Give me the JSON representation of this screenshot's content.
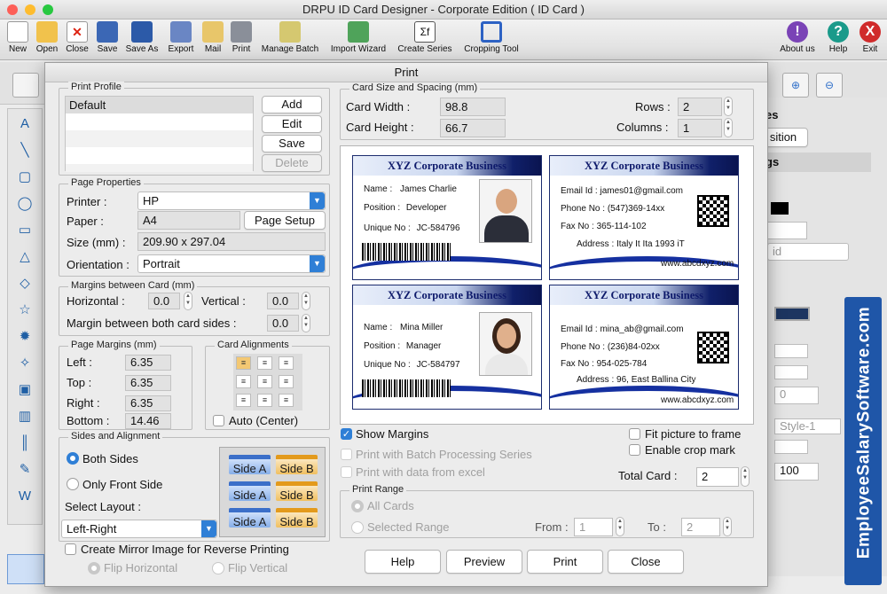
{
  "app": {
    "title": "DRPU ID Card Designer - Corporate Edition ( ID Card )"
  },
  "toolbar": {
    "items": [
      {
        "label": "New",
        "icon": "new-icon"
      },
      {
        "label": "Open",
        "icon": "open-icon"
      },
      {
        "label": "Close",
        "icon": "close-doc-icon"
      },
      {
        "label": "Save",
        "icon": "save-icon"
      },
      {
        "label": "Save As",
        "icon": "save-as-icon"
      },
      {
        "label": "Export",
        "icon": "export-icon"
      },
      {
        "label": "Mail",
        "icon": "mail-icon"
      },
      {
        "label": "Print",
        "icon": "print-icon"
      },
      {
        "label": "Manage Batch",
        "icon": "manage-batch-icon"
      },
      {
        "label": "Import Wizard",
        "icon": "import-wizard-icon"
      },
      {
        "label": "Create Series",
        "icon": "create-series-icon"
      },
      {
        "label": "Cropping Tool",
        "icon": "cropping-tool-icon"
      }
    ],
    "right_items": [
      {
        "label": "About us",
        "glyph": "!"
      },
      {
        "label": "Help",
        "glyph": "?"
      },
      {
        "label": "Exit",
        "glyph": "X"
      }
    ]
  },
  "background_panel": {
    "labels": [
      "es",
      "sition",
      "gs"
    ],
    "values": [
      "id",
      "0",
      "Style-1",
      "100"
    ]
  },
  "dialog": {
    "title": "Print",
    "print_profile": {
      "legend": "Print Profile",
      "items": [
        "Default"
      ],
      "buttons": {
        "add": "Add",
        "edit": "Edit",
        "save": "Save",
        "delete": "Delete"
      }
    },
    "page_properties": {
      "legend": "Page Properties",
      "printer_label": "Printer :",
      "printer_value": "HP",
      "paper_label": "Paper :",
      "paper_value": "A4",
      "page_setup": "Page Setup",
      "size_label": "Size (mm) :",
      "size_value": "209.90 x 297.04",
      "orientation_label": "Orientation :",
      "orientation_value": "Portrait"
    },
    "margins_between_card": {
      "legend": "Margins between Card (mm)",
      "horizontal_label": "Horizontal :",
      "horizontal_value": "0.0",
      "vertical_label": "Vertical :",
      "vertical_value": "0.0",
      "both_sides_label": "Margin between both card sides :",
      "both_sides_value": "0.0"
    },
    "page_margins": {
      "legend": "Page Margins (mm)",
      "left_label": "Left :",
      "left_value": "6.35",
      "top_label": "Top :",
      "top_value": "6.35",
      "right_label": "Right :",
      "right_value": "6.35",
      "bottom_label": "Bottom :",
      "bottom_value": "14.46"
    },
    "card_alignments": {
      "legend": "Card Alignments",
      "auto_center": "Auto (Center)"
    },
    "sides_alignment": {
      "legend": "Sides and Alignment",
      "both_sides": "Both Sides",
      "front_only": "Only Front Side",
      "select_layout": "Select Layout :",
      "layout_value": "Left-Right",
      "side_a": "Side A",
      "side_b": "Side B"
    },
    "mirror": {
      "label": "Create Mirror Image for Reverse Printing",
      "flip_h": "Flip Horizontal",
      "flip_v": "Flip Vertical"
    },
    "card_size": {
      "legend": "Card Size and Spacing (mm)",
      "width_label": "Card Width :",
      "width_value": "98.8",
      "height_label": "Card Height :",
      "height_value": "66.7",
      "rows_label": "Rows :",
      "rows_value": "2",
      "columns_label": "Columns :",
      "columns_value": "1"
    },
    "cards": {
      "company": "XYZ Corporate Business",
      "front": [
        {
          "name_label": "Name :",
          "name": "James Charlie",
          "position_label": "Position :",
          "position": "Developer",
          "unique_label": "Unique No :",
          "unique": "JC-584796"
        },
        {
          "name_label": "Name :",
          "name": "Mina Miller",
          "position_label": "Position :",
          "position": "Manager",
          "unique_label": "Unique No :",
          "unique": "JC-584797"
        }
      ],
      "back": [
        {
          "email_label": "Email Id :",
          "email": "james01@gmail.com",
          "phone_label": "Phone No :",
          "phone": "(547)369-14xx",
          "fax_label": "Fax No :",
          "fax": "365-114-102",
          "address_label": "Address :",
          "address": "Italy It Ita 1993 iT",
          "website": "www.abcdxyz.com"
        },
        {
          "email_label": "Email Id :",
          "email": "mina_ab@gmail.com",
          "phone_label": "Phone No :",
          "phone": "(236)84-02xx",
          "fax_label": "Fax No :",
          "fax": "954-025-784",
          "address_label": "Address :",
          "address": "96, East Ballina City",
          "website": "www.abcdxyz.com"
        }
      ]
    },
    "options": {
      "show_margins": "Show Margins",
      "batch_series": "Print with Batch Processing Series",
      "data_excel": "Print with data from excel",
      "fit_picture": "Fit picture to frame",
      "crop_mark": "Enable crop mark",
      "total_card_label": "Total Card :",
      "total_card_value": "2"
    },
    "print_range": {
      "legend": "Print Range",
      "all_cards": "All Cards",
      "selected_range": "Selected Range",
      "from_label": "From :",
      "from_value": "1",
      "to_label": "To :",
      "to_value": "2"
    },
    "buttons": {
      "help": "Help",
      "preview": "Preview",
      "print": "Print",
      "close": "Close"
    }
  },
  "watermark": "EmployeeSalarySoftware.com"
}
